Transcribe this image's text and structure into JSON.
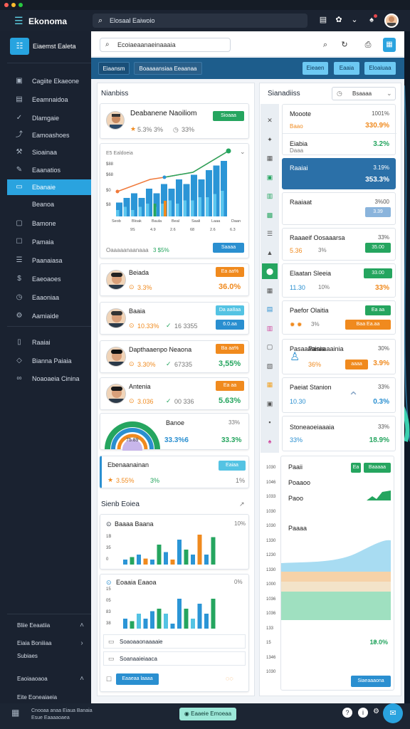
{
  "app": {
    "title": "Ekonoma"
  },
  "header": {
    "search_text": "Elosaal Eaiwoio"
  },
  "sidebar": {
    "workspace_label": "Eiaemst Ealeta",
    "items": [
      {
        "label": "Cagiite Ekaeone",
        "icon": "grid-icon"
      },
      {
        "label": "Eeamnaidoa",
        "icon": "document-icon"
      },
      {
        "label": "Dlamgaie",
        "icon": "check-icon"
      },
      {
        "label": "Eamoashoes",
        "icon": "route-icon"
      },
      {
        "label": "Sioainaa",
        "icon": "wrench-icon"
      },
      {
        "label": "Eaanatios",
        "icon": "tools-icon"
      },
      {
        "label": "Ebanaie",
        "icon": "card-icon"
      },
      {
        "label": "Beanoa",
        "icon": ""
      },
      {
        "label": "Bamone",
        "icon": "box-icon"
      },
      {
        "label": "Pamaia",
        "icon": "bell-icon"
      },
      {
        "label": "Paanaiasa",
        "icon": "list-icon"
      },
      {
        "label": "Eaeoaoes",
        "icon": "dollar-icon"
      },
      {
        "label": "Eaaoniaa",
        "icon": "clock-icon"
      },
      {
        "label": "Aamiaide",
        "icon": "gear-icon"
      },
      {
        "label": "Raaiai",
        "icon": "file-icon"
      },
      {
        "label": "Bianna Paiaia",
        "icon": "shield-icon"
      },
      {
        "label": "Noaoaeia Cinina",
        "icon": "link-icon"
      }
    ],
    "footer_sections": [
      {
        "label": "Bliie Eeaatiia"
      },
      {
        "label": "Eiaia Boniiiaa"
      },
      {
        "label": "Subiaes"
      },
      {
        "label": "Eaoiaaoaoa"
      },
      {
        "label": "Eite Eoneaiaeia"
      }
    ],
    "footer_meta": [
      "Cnooaa anaa Eiaua Banaia",
      "Esue Eaaaaoaea"
    ]
  },
  "toolbar": {
    "search_text": "Ecoiaeaanaeinaaaia"
  },
  "tabs": {
    "left": [
      "Eiaansm",
      "Boaaaansiaa",
      "Eeaanaa"
    ],
    "right": [
      "Eieaen",
      "Eaaia",
      "Eloaiuaa"
    ]
  },
  "left_panel": {
    "title": "Nianbiss",
    "top_card": {
      "name": "Deabanene Naoiliom",
      "stat1": "5.3% 3%",
      "stat2": "33%",
      "button": "Sioaaa"
    },
    "chart": {
      "y_title": "E5 Ealdoeia",
      "footer_left": "Oaaaaanaanaaa",
      "footer_mid": "3 $5%",
      "button": "Saaaa"
    },
    "people": [
      {
        "name": "Beiada",
        "stat1": "3.3%",
        "badge": "Ea aa%",
        "value": "36.0%",
        "badge_color": "#f08a1e"
      },
      {
        "name": "Baaia",
        "stat1": "10.33%",
        "stat2": "16 3355",
        "badge": "Da aa8aa",
        "badge2": "6.0.aa",
        "value": "",
        "badge_color": "#54c3e3"
      },
      {
        "name": "Dapthaaenpo Neaona",
        "stat1": "3.30%",
        "stat2": "67335",
        "badge": "Ba aa%",
        "value": "3,55%",
        "badge_color": "#f08a1e"
      },
      {
        "name": "Antenia",
        "stat1": "3.036",
        "stat2": "00 336",
        "badge": "Ea aa",
        "value": "5.63%",
        "badge_color": "#f08a1e"
      }
    ],
    "gauge_card": {
      "center": "75.89",
      "name": "Banoe",
      "pct": "33%",
      "value1": "33.3%6",
      "value2": "33.3%"
    },
    "note_card": {
      "title": "Ebenaanainan",
      "stat1": "3.55%",
      "stat2": "3%",
      "badge": "Eaiaa",
      "small": "1%"
    },
    "section2_title": "Sienb Eoiea",
    "mini1": {
      "title": "Baaaa Baana",
      "pct": "10%"
    },
    "mini2": {
      "title": "Eoaaia Eaaoa",
      "pct": "0%"
    },
    "list_rows": [
      "Soaoaaonaaaaie",
      "Soanaaieiaaca"
    ],
    "footer_button": "Eaaeaa laaaa"
  },
  "right_panel": {
    "title": "Sianadiiss",
    "dropdown": "Bsaaaa",
    "rows": [
      {
        "title": "Mooote",
        "val": "1001%",
        "sub": "Baao",
        "big": "330.9%"
      },
      {
        "title": "Eiabia",
        "val": "",
        "sub": "Daaa",
        "big": "3.2%"
      },
      {
        "title": "Raaiai",
        "val": "3.19%",
        "sub": "",
        "big": "353.3%"
      },
      {
        "title": "Raaiaat",
        "val": "3%00",
        "sub": "",
        "badge": "3.39"
      },
      {
        "title": "Raaaeif Oosaaarsa",
        "val": "33%",
        "sub": "5.36",
        "pct": "3%",
        "badge": "35.00"
      },
      {
        "title": "Elaatan Sleeia",
        "val": "",
        "sub": "11.30",
        "pct": "10%",
        "badge": "33.00",
        "big": "33%"
      },
      {
        "title": "Paefor Olaitia",
        "val": "",
        "sub": "3%",
        "badge": "Ea aa",
        "badge2": "Baa Ea.aa"
      },
      {
        "title": "Pasaaaainia",
        "val": "30%",
        "sub": "36%",
        "badge": "aaaa",
        "big": "3.9%"
      },
      {
        "title": "Paeiat Stanion",
        "val": "33%",
        "sub": "10.30",
        "big": "0.3%"
      },
      {
        "title": "Stoneaoeiaaaia",
        "val": "33%",
        "sub": "33%",
        "big": "18.9%"
      }
    ],
    "area_card": {
      "rows": [
        "Paaii",
        "Poaaoo",
        "Paoo",
        "Paaaa"
      ],
      "badges": [
        "Ea",
        "Baaaaa"
      ],
      "value": "19.0%",
      "button": "Siaeaaaona"
    },
    "y_ticks": [
      "1030",
      "1046",
      "1033",
      "1030",
      "1030",
      "1330",
      "1230",
      "1330",
      "1000",
      "1036",
      "1036",
      "133",
      "15",
      "1346",
      "1030"
    ]
  },
  "bottom": {
    "center_button": "Eaaeie Emoeaa"
  },
  "colors": {
    "accent": "#2aa3df",
    "green": "#25a55f",
    "orange": "#f08a1e",
    "sidebar": "#1a2230"
  }
}
